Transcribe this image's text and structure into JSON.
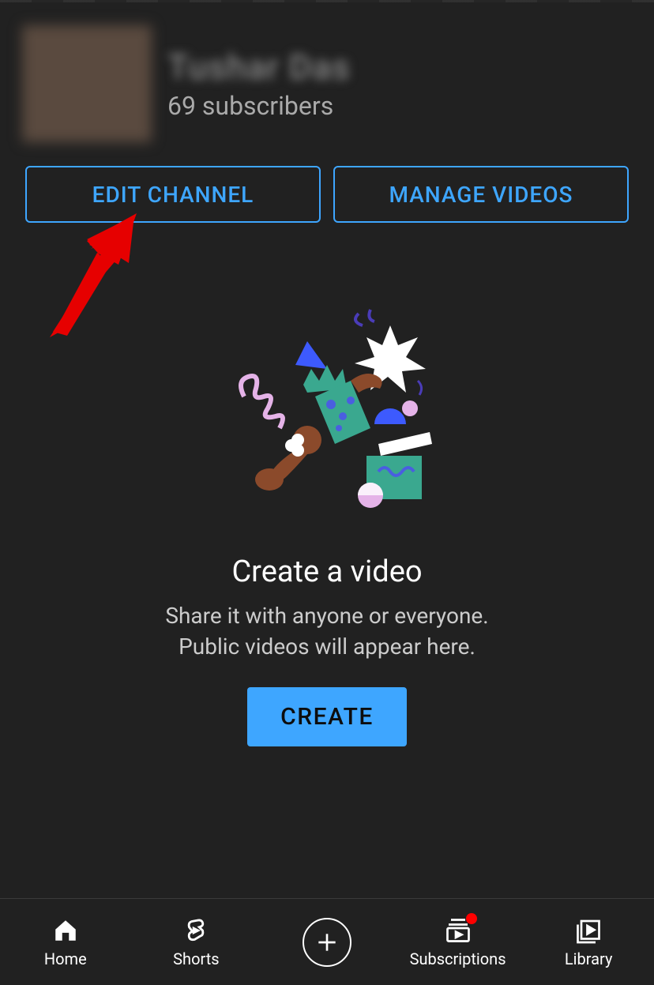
{
  "channel": {
    "name": "Tushar Das",
    "subscribers": "69 subscribers"
  },
  "buttons": {
    "edit_channel": "EDIT CHANNEL",
    "manage_videos": "MANAGE VIDEOS"
  },
  "empty_state": {
    "title": "Create a video",
    "line1": "Share it with anyone or everyone.",
    "line2": "Public videos will appear here.",
    "create_button": "CREATE"
  },
  "nav": {
    "home": "Home",
    "shorts": "Shorts",
    "subscriptions": "Subscriptions",
    "library": "Library"
  },
  "colors": {
    "accent": "#3ea6ff",
    "background": "#212121",
    "notification": "#ff0000"
  }
}
